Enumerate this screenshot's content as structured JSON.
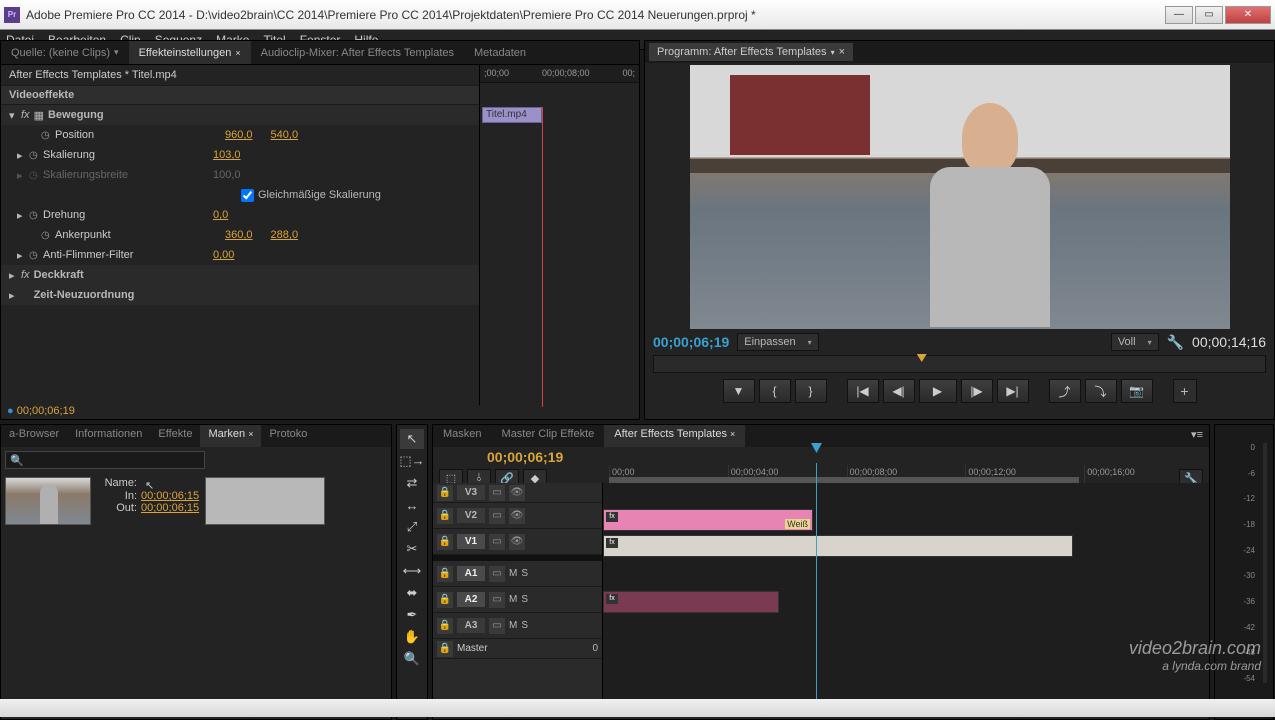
{
  "window": {
    "app_icon": "Pr",
    "title": "Adobe Premiere Pro CC 2014 - D:\\video2brain\\CC 2014\\Premiere Pro CC 2014\\Projektdaten\\Premiere Pro CC 2014 Neuerungen.prproj *"
  },
  "menu": [
    "Datei",
    "Bearbeiten",
    "Clip",
    "Sequenz",
    "Marke",
    "Titel",
    "Fenster",
    "Hilfe"
  ],
  "source_tabs": {
    "source": "Quelle: (keine Clips)",
    "effects": "Effekteinstellungen",
    "mixer": "Audioclip-Mixer: After Effects Templates",
    "metadata": "Metadaten"
  },
  "fx": {
    "header": "After Effects Templates * Titel.mp4",
    "section_video": "Videoeffekte",
    "group_motion": "Bewegung",
    "props": {
      "position_label": "Position",
      "position_x": "960,0",
      "position_y": "540,0",
      "scale_label": "Skalierung",
      "scale_val": "103,0",
      "scalew_label": "Skalierungsbreite",
      "scalew_val": "100,0",
      "uniform_label": "Gleichmäßige Skalierung",
      "rotation_label": "Drehung",
      "rotation_val": "0,0",
      "anchor_label": "Ankerpunkt",
      "anchor_x": "360,0",
      "anchor_y": "288,0",
      "flicker_label": "Anti-Flimmer-Filter",
      "flicker_val": "0,00"
    },
    "group_opacity": "Deckkraft",
    "group_timeremap": "Zeit-Neuzuordnung",
    "footer_tc": "00;00;06;19"
  },
  "mini_timeline": {
    "ruler": [
      ";00;00",
      "00;00;08;00",
      "00;"
    ],
    "clip_label": "Titel.mp4"
  },
  "program": {
    "tab_label": "Programm: After Effects Templates",
    "current_tc": "00;00;06;19",
    "fit_label": "Einpassen",
    "zoom_label": "Voll",
    "duration": "00;00;14;16"
  },
  "browser": {
    "tabs": [
      "a-Browser",
      "Informationen",
      "Effekte",
      "Marken",
      "Protoko"
    ],
    "active_idx": 3,
    "search_placeholder": "",
    "marker": {
      "name_label": "Name:",
      "in_label": "In:",
      "out_label": "Out:",
      "in_tc": "00;00;06;15",
      "out_tc": "00;00;06;15"
    }
  },
  "timeline": {
    "tabs": [
      "Masken",
      "Master Clip Effekte",
      "After Effects Templates"
    ],
    "active_idx": 2,
    "current_tc": "00;00;06;19",
    "ruler": [
      "00;00",
      "00;00;04;00",
      "00;00;08;00",
      "00;00;12;00",
      "00;00;16;00"
    ],
    "tracks": {
      "v3": "V3",
      "v2": "V2",
      "v1": "V1",
      "a1": "A1",
      "a2": "A2",
      "a3": "A3",
      "master": "Master"
    },
    "clip_v2_label": "Weiß",
    "track_letters": {
      "m": "M",
      "s": "S"
    }
  },
  "meters": {
    "scale": [
      "0",
      "-6",
      "-12",
      "-18",
      "-24",
      "-30",
      "-36",
      "-42",
      "-48",
      "-54"
    ]
  },
  "watermark": {
    "line1": "video2brain.com",
    "line2": "a lynda.com brand"
  }
}
